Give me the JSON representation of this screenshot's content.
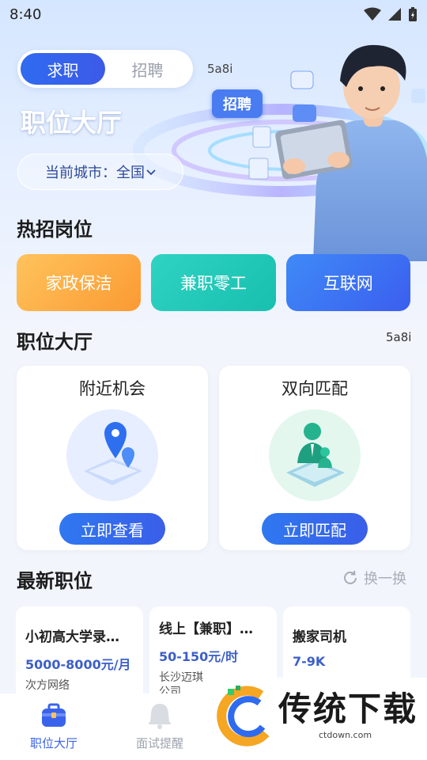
{
  "status_bar": {
    "time": "8:40"
  },
  "header": {
    "tabs": [
      {
        "label": "求职",
        "active": true
      },
      {
        "label": "招聘",
        "active": false
      }
    ],
    "code_tag": "5a8i",
    "title": "职位大厅",
    "city_button": "当前城市：全国",
    "illustration_bubble": "招聘"
  },
  "hot_jobs": {
    "title": "热招岗位",
    "items": [
      {
        "label": "家政保洁"
      },
      {
        "label": "兼职零工"
      },
      {
        "label": "互联网"
      }
    ]
  },
  "hall": {
    "title": "职位大厅",
    "code_tag": "5a8i",
    "cards": [
      {
        "title": "附近机会",
        "button": "立即查看"
      },
      {
        "title": "双向匹配",
        "button": "立即匹配"
      }
    ]
  },
  "latest": {
    "title": "最新职位",
    "refresh_label": "换一换",
    "jobs": [
      {
        "title": "小初高大学录…",
        "salary": "5000-8000元/月",
        "company": "次方网络"
      },
      {
        "title": "线上【兼职】…",
        "salary": "50-150元/时",
        "company": "长沙迈琪\n公司"
      },
      {
        "title": "搬家司机",
        "salary": "7-9K",
        "company": ""
      }
    ]
  },
  "tabbar": {
    "items": [
      {
        "label": "职位大厅",
        "active": true
      },
      {
        "label": "面试提醒",
        "active": false
      }
    ]
  },
  "watermark": {
    "text": "传统下载",
    "url": "ctdown.com"
  },
  "colors": {
    "primary": "#3a63eb",
    "orange": "#fb9a33",
    "teal": "#18bfae",
    "salary": "#3c5fc8"
  }
}
